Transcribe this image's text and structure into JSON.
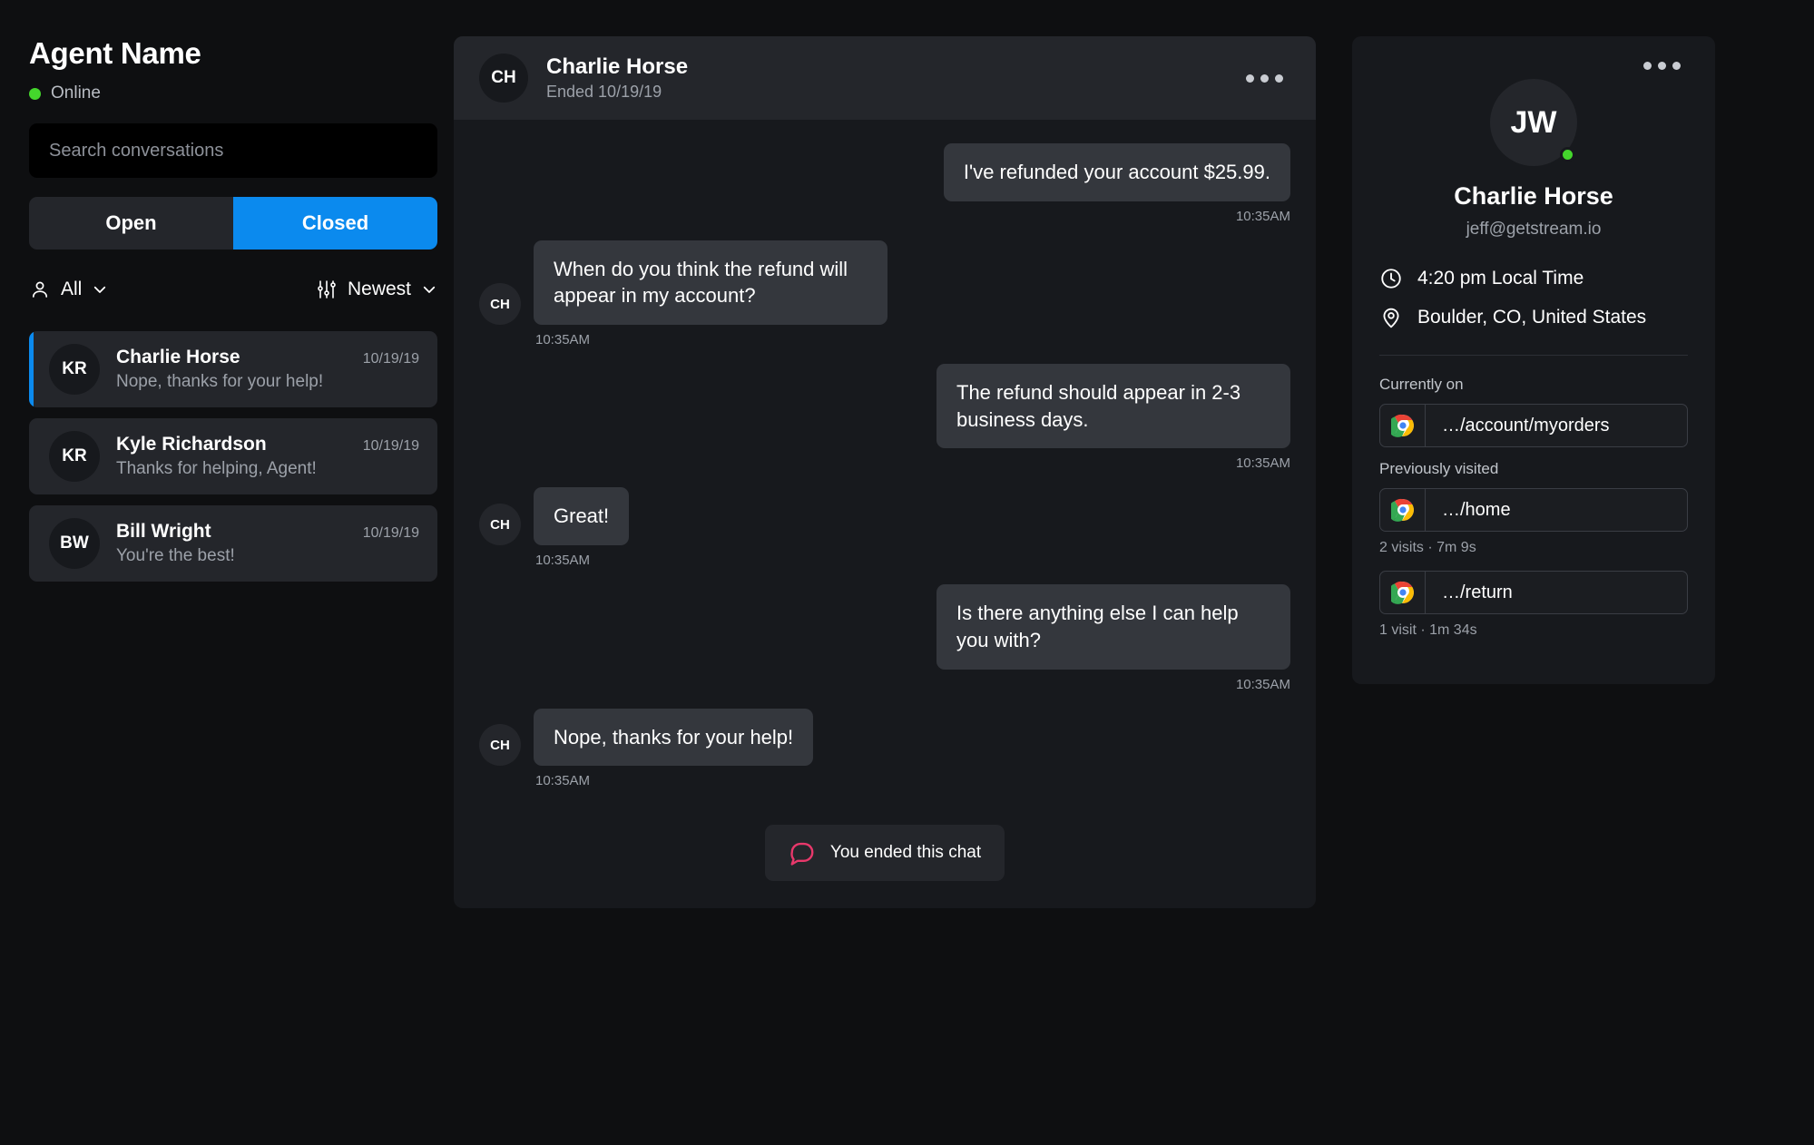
{
  "sidebar": {
    "agent_name": "Agent Name",
    "status": {
      "label": "Online",
      "color": "#44d62c"
    },
    "search": {
      "placeholder": "Search conversations",
      "value": ""
    },
    "tabs": [
      {
        "label": "Open",
        "active": false
      },
      {
        "label": "Closed",
        "active": true
      }
    ],
    "filters": {
      "assignee": {
        "icon": "person-icon",
        "label": "All",
        "chevron": "chevron-down-icon"
      },
      "sort": {
        "icon": "sliders-icon",
        "label": "Newest",
        "chevron": "chevron-down-icon"
      }
    },
    "conversations": [
      {
        "initials": "KR",
        "name": "Charlie Horse",
        "date": "10/19/19",
        "preview": "Nope, thanks for your help!",
        "selected": true
      },
      {
        "initials": "KR",
        "name": "Kyle Richardson",
        "date": "10/19/19",
        "preview": "Thanks for helping, Agent!",
        "selected": false
      },
      {
        "initials": "BW",
        "name": "Bill Wright",
        "date": "10/19/19",
        "preview": "You're the best!",
        "selected": false
      }
    ]
  },
  "chat": {
    "header": {
      "initials": "CH",
      "title": "Charlie Horse",
      "subtitle": "Ended 10/19/19",
      "menu_icon": "more-options-icon"
    },
    "messages": [
      {
        "direction": "out",
        "text": "I've refunded your account $25.99.",
        "time": "10:35AM",
        "initials": ""
      },
      {
        "direction": "in",
        "text": "When do you think the refund will appear in my account?",
        "time": "10:35AM",
        "initials": "CH"
      },
      {
        "direction": "out",
        "text": "The refund should appear in 2-3 business days.",
        "time": "10:35AM",
        "initials": ""
      },
      {
        "direction": "in",
        "text": "Great!",
        "time": "10:35AM",
        "initials": "CH"
      },
      {
        "direction": "out",
        "text": "Is there anything else I can help you with?",
        "time": "10:35AM",
        "initials": ""
      },
      {
        "direction": "in",
        "text": "Nope, thanks for your help!",
        "time": "10:35AM",
        "initials": "CH"
      }
    ],
    "ended_notice": {
      "icon": "chat-ended-icon",
      "label": "You ended this chat"
    }
  },
  "profile": {
    "menu_icon": "more-options-icon",
    "initials": "JW",
    "name": "Charlie Horse",
    "email": "jeff@getstream.io",
    "online_color": "#44d62c",
    "meta": [
      {
        "icon": "clock-icon",
        "text": "4:20 pm Local Time"
      },
      {
        "icon": "location-pin-icon",
        "text": "Boulder, CO, United States"
      }
    ],
    "currently_on": {
      "label": "Currently on",
      "url": "…/account/myorders",
      "browser_icon": "chrome-icon"
    },
    "previously_visited": {
      "label": "Previously visited",
      "entries": [
        {
          "url": "…/home",
          "browser_icon": "chrome-icon",
          "stats": "2 visits · 7m 9s"
        },
        {
          "url": "…/return",
          "browser_icon": "chrome-icon",
          "stats": "1 visit · 1m 34s"
        }
      ]
    }
  },
  "theme": {
    "accent": "#0b8aee",
    "bg": "#0e0f11",
    "card": "#17191d",
    "surface": "#24262b",
    "bubble": "#34373d",
    "muted": "#9ca1a9"
  }
}
